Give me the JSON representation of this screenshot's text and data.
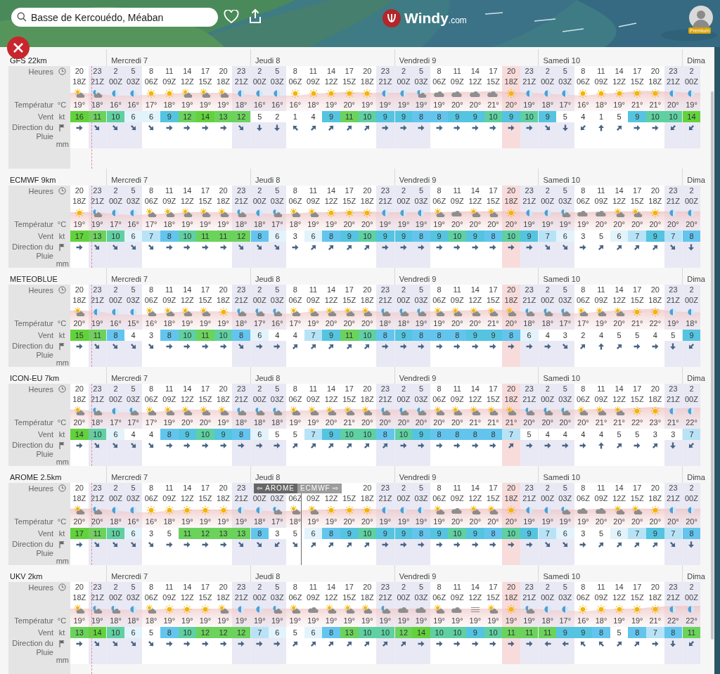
{
  "search": {
    "value": "Basse de Kercouédo, Méaban"
  },
  "logo": {
    "name": "Windy",
    "suffix": ".com"
  },
  "account": {
    "badge": "Premium"
  },
  "columns": [
    {
      "night": false,
      "highlight": false,
      "day_start": false
    },
    {
      "night": true,
      "highlight": false,
      "day_start": false
    },
    {
      "night": true,
      "highlight": false,
      "day_start": true
    },
    {
      "night": true,
      "highlight": false,
      "day_start": false
    },
    {
      "night": false,
      "highlight": false,
      "day_start": false
    },
    {
      "night": false,
      "highlight": false,
      "day_start": false
    },
    {
      "night": false,
      "highlight": false,
      "day_start": false
    },
    {
      "night": false,
      "highlight": false,
      "day_start": false
    },
    {
      "night": false,
      "highlight": false,
      "day_start": false
    },
    {
      "night": true,
      "highlight": false,
      "day_start": false
    },
    {
      "night": true,
      "highlight": false,
      "day_start": true
    },
    {
      "night": true,
      "highlight": false,
      "day_start": false
    },
    {
      "night": false,
      "highlight": false,
      "day_start": false
    },
    {
      "night": false,
      "highlight": false,
      "day_start": false
    },
    {
      "night": false,
      "highlight": false,
      "day_start": false
    },
    {
      "night": false,
      "highlight": false,
      "day_start": false
    },
    {
      "night": false,
      "highlight": false,
      "day_start": false
    },
    {
      "night": true,
      "highlight": false,
      "day_start": false
    },
    {
      "night": true,
      "highlight": false,
      "day_start": true
    },
    {
      "night": true,
      "highlight": false,
      "day_start": false
    },
    {
      "night": false,
      "highlight": false,
      "day_start": false
    },
    {
      "night": false,
      "highlight": false,
      "day_start": false
    },
    {
      "night": false,
      "highlight": false,
      "day_start": false
    },
    {
      "night": false,
      "highlight": false,
      "day_start": false
    },
    {
      "night": false,
      "highlight": true,
      "day_start": false
    },
    {
      "night": true,
      "highlight": false,
      "day_start": false
    },
    {
      "night": true,
      "highlight": false,
      "day_start": true
    },
    {
      "night": true,
      "highlight": false,
      "day_start": false
    },
    {
      "night": false,
      "highlight": false,
      "day_start": false
    },
    {
      "night": false,
      "highlight": false,
      "day_start": false
    },
    {
      "night": false,
      "highlight": false,
      "day_start": false
    },
    {
      "night": false,
      "highlight": false,
      "day_start": false
    },
    {
      "night": false,
      "highlight": false,
      "day_start": false
    },
    {
      "night": true,
      "highlight": false,
      "day_start": false
    },
    {
      "night": true,
      "highlight": false,
      "day_start": true
    }
  ],
  "models": [
    {
      "name": "GFS 22km",
      "labels": {
        "hours": "Heures",
        "temperature": "Températur",
        "temperature_unit": "°C",
        "wind": "Vent",
        "wind_unit": "kt",
        "direction": "Direction du",
        "rain": "Pluie",
        "rain_unit": "mm"
      },
      "days": [
        "Mercredi 7",
        "Jeudi 8",
        "Vendredi 9",
        "Samedi 10",
        "Dima"
      ],
      "hours": [
        "20",
        "23",
        "2",
        "5",
        "8",
        "11",
        "14",
        "17",
        "20",
        "23",
        "2",
        "5",
        "8",
        "11",
        "14",
        "17",
        "20",
        "23",
        "2",
        "5",
        "8",
        "11",
        "14",
        "17",
        "20",
        "23",
        "2",
        "5",
        "8",
        "11",
        "14",
        "17",
        "20",
        "23",
        "2"
      ],
      "utc": [
        "18Z",
        "21Z",
        "00Z",
        "03Z",
        "06Z",
        "09Z",
        "12Z",
        "15Z",
        "18Z",
        "21Z",
        "00Z",
        "03Z",
        "06Z",
        "09Z",
        "12Z",
        "15Z",
        "18Z",
        "21Z",
        "00Z",
        "03Z",
        "06Z",
        "09Z",
        "12Z",
        "15Z",
        "18Z",
        "21Z",
        "00Z",
        "03Z",
        "06Z",
        "09Z",
        "12Z",
        "15Z",
        "18Z",
        "21Z",
        "00Z"
      ],
      "icons": [
        {
          "kind": "sun-cloud"
        },
        {
          "kind": "moon-cloud"
        },
        {
          "kind": "moon"
        },
        {
          "kind": "moon"
        },
        {
          "kind": "sun"
        },
        {
          "kind": "sun"
        },
        {
          "kind": "sun-cloud"
        },
        {
          "kind": "sun-cloud"
        },
        {
          "kind": "sun-cloud"
        },
        {
          "kind": "moon"
        },
        {
          "kind": "moon"
        },
        {
          "kind": "moon"
        },
        {
          "kind": "sun"
        },
        {
          "kind": "sun"
        },
        {
          "kind": "sun"
        },
        {
          "kind": "sun"
        },
        {
          "kind": "sun"
        },
        {
          "kind": "moon"
        },
        {
          "kind": "moon"
        },
        {
          "kind": "moon-cloud"
        },
        {
          "kind": "cloud"
        },
        {
          "kind": "cloud"
        },
        {
          "kind": "cloud"
        },
        {
          "kind": "cloud"
        },
        {
          "kind": "sun"
        },
        {
          "kind": "moon"
        },
        {
          "kind": "moon"
        },
        {
          "kind": "moon"
        },
        {
          "kind": "sun"
        },
        {
          "kind": "sun"
        },
        {
          "kind": "sun"
        },
        {
          "kind": "sun"
        },
        {
          "kind": "sun"
        },
        {
          "kind": "moon"
        },
        {
          "kind": "moon"
        }
      ],
      "temperatures": [
        "19°",
        "18°",
        "16°",
        "16°",
        "17°",
        "18°",
        "19°",
        "19°",
        "19°",
        "18°",
        "16°",
        "16°",
        "16°",
        "18°",
        "19°",
        "20°",
        "19°",
        "19°",
        "19°",
        "19°",
        "19°",
        "20°",
        "20°",
        "21°",
        "20°",
        "19°",
        "18°",
        "17°",
        "16°",
        "18°",
        "19°",
        "21°",
        "21°",
        "20°",
        "19°"
      ],
      "wind": [
        "16",
        "11",
        "10",
        "6",
        "6",
        "9",
        "12",
        "14",
        "13",
        "12",
        "5",
        "2",
        "1",
        "4",
        "9",
        "11",
        "10",
        "9",
        "9",
        "8",
        "8",
        "9",
        "9",
        "10",
        "9",
        "10",
        "9",
        "5",
        "4",
        "1",
        "5",
        "9",
        "10",
        "10",
        "14"
      ],
      "directions": [
        {
          "kind": "e"
        },
        {
          "kind": "se"
        },
        {
          "kind": "se"
        },
        {
          "kind": "se"
        },
        {
          "kind": "se"
        },
        {
          "kind": "e"
        },
        {
          "kind": "e"
        },
        {
          "kind": "e"
        },
        {
          "kind": "e"
        },
        {
          "kind": "se"
        },
        {
          "kind": "s"
        },
        {
          "kind": "s"
        },
        {
          "kind": "nw"
        },
        {
          "kind": "ne"
        },
        {
          "kind": "ne"
        },
        {
          "kind": "ne"
        },
        {
          "kind": "ne"
        },
        {
          "kind": "e"
        },
        {
          "kind": "e"
        },
        {
          "kind": "e"
        },
        {
          "kind": "e"
        },
        {
          "kind": "e"
        },
        {
          "kind": "e"
        },
        {
          "kind": "e"
        },
        {
          "kind": "e"
        },
        {
          "kind": "e"
        },
        {
          "kind": "se"
        },
        {
          "kind": "s"
        },
        {
          "kind": "sw"
        },
        {
          "kind": "n"
        },
        {
          "kind": "ne"
        },
        {
          "kind": "e"
        },
        {
          "kind": "e"
        },
        {
          "kind": "sw"
        },
        {
          "kind": "sw"
        }
      ]
    },
    {
      "name": "ECMWF 9km",
      "labels": {
        "hours": "Heures",
        "temperature": "Températur",
        "temperature_unit": "°C",
        "wind": "Vent",
        "wind_unit": "kt",
        "direction": "Direction du",
        "rain": "Pluie",
        "rain_unit": "mm"
      },
      "days": [
        "Mercredi 7",
        "Jeudi 8",
        "Vendredi 9",
        "Samedi 10",
        "Dima"
      ],
      "hours": [
        "20",
        "23",
        "2",
        "5",
        "8",
        "11",
        "14",
        "17",
        "20",
        "23",
        "2",
        "5",
        "8",
        "11",
        "14",
        "17",
        "20",
        "23",
        "2",
        "5",
        "8",
        "11",
        "14",
        "17",
        "20",
        "23",
        "2",
        "5",
        "8",
        "11",
        "14",
        "17",
        "20",
        "23",
        "2"
      ],
      "utc": [
        "18Z",
        "21Z",
        "00Z",
        "03Z",
        "06Z",
        "09Z",
        "12Z",
        "15Z",
        "18Z",
        "21Z",
        "00Z",
        "03Z",
        "06Z",
        "09Z",
        "12Z",
        "15Z",
        "18Z",
        "21Z",
        "00Z",
        "03Z",
        "06Z",
        "09Z",
        "12Z",
        "15Z",
        "18Z",
        "21Z",
        "00Z",
        "03Z",
        "06Z",
        "09Z",
        "12Z",
        "15Z",
        "18Z",
        "21Z",
        "00Z"
      ],
      "icons": [
        {
          "kind": "sun"
        },
        {
          "kind": "moon-cloud"
        },
        {
          "kind": "moon"
        },
        {
          "kind": "moon"
        },
        {
          "kind": "sun-cloud"
        },
        {
          "kind": "sun-cloud"
        },
        {
          "kind": "sun-cloud"
        },
        {
          "kind": "sun-cloud"
        },
        {
          "kind": "sun-cloud"
        },
        {
          "kind": "moon-cloud"
        },
        {
          "kind": "moon"
        },
        {
          "kind": "moon-cloud"
        },
        {
          "kind": "sun-cloud"
        },
        {
          "kind": "sun-cloud"
        },
        {
          "kind": "sun"
        },
        {
          "kind": "sun"
        },
        {
          "kind": "sun"
        },
        {
          "kind": "moon"
        },
        {
          "kind": "moon"
        },
        {
          "kind": "moon"
        },
        {
          "kind": "sun-cloud"
        },
        {
          "kind": "cloud"
        },
        {
          "kind": "sun-cloud"
        },
        {
          "kind": "sun-cloud"
        },
        {
          "kind": "sun"
        },
        {
          "kind": "moon"
        },
        {
          "kind": "moon"
        },
        {
          "kind": "moon-cloud"
        },
        {
          "kind": "cloud"
        },
        {
          "kind": "cloud"
        },
        {
          "kind": "sun-cloud"
        },
        {
          "kind": "sun-cloud"
        },
        {
          "kind": "sun"
        },
        {
          "kind": "moon"
        },
        {
          "kind": "moon"
        }
      ],
      "temperatures": [
        "19°",
        "19°",
        "17°",
        "16°",
        "17°",
        "18°",
        "19°",
        "19°",
        "19°",
        "18°",
        "18°",
        "17°",
        "18°",
        "19°",
        "19°",
        "20°",
        "20°",
        "19°",
        "19°",
        "19°",
        "19°",
        "20°",
        "20°",
        "20°",
        "20°",
        "19°",
        "19°",
        "19°",
        "19°",
        "20°",
        "20°",
        "20°",
        "20°",
        "20°",
        "20°"
      ],
      "wind": [
        "17",
        "13",
        "10",
        "6",
        "7",
        "8",
        "10",
        "11",
        "11",
        "12",
        "8",
        "6",
        "3",
        "6",
        "8",
        "9",
        "10",
        "9",
        "9",
        "8",
        "9",
        "10",
        "9",
        "8",
        "10",
        "9",
        "7",
        "6",
        "3",
        "5",
        "6",
        "7",
        "9",
        "7",
        "8"
      ],
      "directions": [
        {
          "kind": "e"
        },
        {
          "kind": "se"
        },
        {
          "kind": "se"
        },
        {
          "kind": "se"
        },
        {
          "kind": "se"
        },
        {
          "kind": "e"
        },
        {
          "kind": "e"
        },
        {
          "kind": "e"
        },
        {
          "kind": "e"
        },
        {
          "kind": "se"
        },
        {
          "kind": "se"
        },
        {
          "kind": "se"
        },
        {
          "kind": "e"
        },
        {
          "kind": "ne"
        },
        {
          "kind": "ne"
        },
        {
          "kind": "ne"
        },
        {
          "kind": "ne"
        },
        {
          "kind": "e"
        },
        {
          "kind": "e"
        },
        {
          "kind": "e"
        },
        {
          "kind": "e"
        },
        {
          "kind": "e"
        },
        {
          "kind": "e"
        },
        {
          "kind": "e"
        },
        {
          "kind": "e"
        },
        {
          "kind": "e"
        },
        {
          "kind": "se"
        },
        {
          "kind": "se"
        },
        {
          "kind": "e"
        },
        {
          "kind": "ne"
        },
        {
          "kind": "ne"
        },
        {
          "kind": "ne"
        },
        {
          "kind": "ne"
        },
        {
          "kind": "se"
        },
        {
          "kind": "s"
        }
      ]
    },
    {
      "name": "METEOBLUE",
      "labels": {
        "hours": "Heures",
        "temperature": "Températur",
        "temperature_unit": "°C",
        "wind": "Vent",
        "wind_unit": "kt",
        "direction": "Direction du",
        "rain": "Pluie",
        "rain_unit": "mm"
      },
      "days": [
        "Mercredi 7",
        "Jeudi 8",
        "Vendredi 9",
        "Samedi 10",
        "Dima"
      ],
      "hours": [
        "20",
        "23",
        "2",
        "5",
        "8",
        "11",
        "14",
        "17",
        "20",
        "23",
        "2",
        "5",
        "8",
        "11",
        "14",
        "17",
        "20",
        "23",
        "2",
        "5",
        "8",
        "11",
        "14",
        "17",
        "20",
        "23",
        "2",
        "5",
        "8",
        "11",
        "14",
        "17",
        "20",
        "23",
        "2"
      ],
      "utc": [
        "18Z",
        "21Z",
        "00Z",
        "03Z",
        "06Z",
        "09Z",
        "12Z",
        "15Z",
        "18Z",
        "21Z",
        "00Z",
        "03Z",
        "06Z",
        "09Z",
        "12Z",
        "15Z",
        "18Z",
        "21Z",
        "00Z",
        "03Z",
        "06Z",
        "09Z",
        "12Z",
        "15Z",
        "18Z",
        "21Z",
        "00Z",
        "03Z",
        "06Z",
        "09Z",
        "12Z",
        "15Z",
        "18Z",
        "21Z",
        "00Z"
      ],
      "icons": [
        {
          "kind": "sun-cloud"
        },
        {
          "kind": "moon"
        },
        {
          "kind": "moon"
        },
        {
          "kind": "moon"
        },
        {
          "kind": "sun-cloud"
        },
        {
          "kind": "sun-cloud"
        },
        {
          "kind": "sun-cloud"
        },
        {
          "kind": "sun-cloud"
        },
        {
          "kind": "sun"
        },
        {
          "kind": "moon-cloud"
        },
        {
          "kind": "moon-cloud"
        },
        {
          "kind": "moon-cloud"
        },
        {
          "kind": "sun-cloud"
        },
        {
          "kind": "sun-cloud"
        },
        {
          "kind": "sun-cloud"
        },
        {
          "kind": "sun-cloud"
        },
        {
          "kind": "sun-cloud"
        },
        {
          "kind": "moon-cloud"
        },
        {
          "kind": "moon-cloud"
        },
        {
          "kind": "moon-cloud"
        },
        {
          "kind": "sun-cloud"
        },
        {
          "kind": "sun-cloud"
        },
        {
          "kind": "sun-cloud"
        },
        {
          "kind": "sun-cloud"
        },
        {
          "kind": "sun-cloud"
        },
        {
          "kind": "moon-cloud"
        },
        {
          "kind": "moon-cloud"
        },
        {
          "kind": "moon-cloud"
        },
        {
          "kind": "sun-cloud"
        },
        {
          "kind": "sun-cloud"
        },
        {
          "kind": "sun-cloud"
        },
        {
          "kind": "sun"
        },
        {
          "kind": "sun"
        },
        {
          "kind": "moon"
        },
        {
          "kind": "moon"
        }
      ],
      "temperatures": [
        "20°",
        "19°",
        "16°",
        "15°",
        "16°",
        "18°",
        "19°",
        "19°",
        "19°",
        "18°",
        "17°",
        "16°",
        "17°",
        "19°",
        "20°",
        "20°",
        "20°",
        "18°",
        "18°",
        "19°",
        "19°",
        "20°",
        "20°",
        "21°",
        "20°",
        "18°",
        "18°",
        "17°",
        "17°",
        "19°",
        "20°",
        "21°",
        "22°",
        "19°",
        "18°"
      ],
      "wind": [
        "15",
        "11",
        "8",
        "4",
        "3",
        "8",
        "10",
        "11",
        "10",
        "8",
        "6",
        "4",
        "4",
        "7",
        "9",
        "11",
        "10",
        "8",
        "9",
        "8",
        "8",
        "8",
        "9",
        "9",
        "8",
        "6",
        "4",
        "3",
        "2",
        "4",
        "5",
        "5",
        "4",
        "5",
        "9"
      ],
      "directions": [
        {
          "kind": "e"
        },
        {
          "kind": "se"
        },
        {
          "kind": "se"
        },
        {
          "kind": "se"
        },
        {
          "kind": "se"
        },
        {
          "kind": "e"
        },
        {
          "kind": "e"
        },
        {
          "kind": "e"
        },
        {
          "kind": "e"
        },
        {
          "kind": "se"
        },
        {
          "kind": "e"
        },
        {
          "kind": "e"
        },
        {
          "kind": "ne"
        },
        {
          "kind": "ne"
        },
        {
          "kind": "ne"
        },
        {
          "kind": "ne"
        },
        {
          "kind": "ne"
        },
        {
          "kind": "e"
        },
        {
          "kind": "e"
        },
        {
          "kind": "e"
        },
        {
          "kind": "e"
        },
        {
          "kind": "e"
        },
        {
          "kind": "e"
        },
        {
          "kind": "e"
        },
        {
          "kind": "e"
        },
        {
          "kind": "e"
        },
        {
          "kind": "e"
        },
        {
          "kind": "se"
        },
        {
          "kind": "ne"
        },
        {
          "kind": "n"
        },
        {
          "kind": "ne"
        },
        {
          "kind": "e"
        },
        {
          "kind": "e"
        },
        {
          "kind": "s"
        },
        {
          "kind": "sw"
        }
      ]
    },
    {
      "name": "ICON-EU 7km",
      "labels": {
        "hours": "Heures",
        "temperature": "Températur",
        "temperature_unit": "°C",
        "wind": "Vent",
        "wind_unit": "kt",
        "direction": "Direction du",
        "rain": "Pluie",
        "rain_unit": "mm"
      },
      "days": [
        "Mercredi 7",
        "Jeudi 8",
        "Vendredi 9",
        "Samedi 10",
        "Dima"
      ],
      "hours": [
        "20",
        "23",
        "2",
        "5",
        "8",
        "11",
        "14",
        "17",
        "20",
        "23",
        "2",
        "5",
        "8",
        "11",
        "14",
        "17",
        "20",
        "23",
        "2",
        "5",
        "8",
        "11",
        "14",
        "17",
        "20",
        "23",
        "2",
        "5",
        "8",
        "11",
        "14",
        "17",
        "20",
        "23",
        "2"
      ],
      "utc": [
        "18Z",
        "21Z",
        "00Z",
        "03Z",
        "06Z",
        "09Z",
        "12Z",
        "15Z",
        "18Z",
        "21Z",
        "00Z",
        "03Z",
        "06Z",
        "09Z",
        "12Z",
        "15Z",
        "18Z",
        "21Z",
        "00Z",
        "03Z",
        "06Z",
        "09Z",
        "12Z",
        "15Z",
        "18Z",
        "21Z",
        "00Z",
        "03Z",
        "06Z",
        "09Z",
        "12Z",
        "15Z",
        "18Z",
        "21Z",
        "00Z"
      ],
      "icons": [
        {
          "kind": "sun-cloud"
        },
        {
          "kind": "moon-cloud"
        },
        {
          "kind": "moon"
        },
        {
          "kind": "moon-cloud"
        },
        {
          "kind": "sun-cloud"
        },
        {
          "kind": "sun-cloud"
        },
        {
          "kind": "sun-cloud"
        },
        {
          "kind": "sun-cloud"
        },
        {
          "kind": "sun-cloud"
        },
        {
          "kind": "moon-cloud"
        },
        {
          "kind": "moon-cloud"
        },
        {
          "kind": "moon-cloud"
        },
        {
          "kind": "sun-cloud"
        },
        {
          "kind": "sun-cloud"
        },
        {
          "kind": "sun-cloud"
        },
        {
          "kind": "sun-cloud"
        },
        {
          "kind": "sun-cloud"
        },
        {
          "kind": "moon-cloud"
        },
        {
          "kind": "moon-cloud"
        },
        {
          "kind": "moon-cloud"
        },
        {
          "kind": "sun-cloud"
        },
        {
          "kind": "sun-cloud"
        },
        {
          "kind": "sun-cloud"
        },
        {
          "kind": "sun-cloud"
        },
        {
          "kind": "sun-cloud"
        },
        {
          "kind": "moon-cloud"
        },
        {
          "kind": "moon-cloud"
        },
        {
          "kind": "moon-cloud"
        },
        {
          "kind": "sun-cloud"
        },
        {
          "kind": "sun-cloud"
        },
        {
          "kind": "sun-cloud"
        },
        {
          "kind": "sun"
        },
        {
          "kind": "sun"
        },
        {
          "kind": "moon"
        },
        {
          "kind": "moon"
        }
      ],
      "temperatures": [
        "20°",
        "18°",
        "17°",
        "17°",
        "17°",
        "19°",
        "20°",
        "20°",
        "19°",
        "18°",
        "18°",
        "18°",
        "19°",
        "19°",
        "20°",
        "21°",
        "20°",
        "20°",
        "20°",
        "20°",
        "20°",
        "20°",
        "21°",
        "21°",
        "21°",
        "20°",
        "20°",
        "20°",
        "20°",
        "21°",
        "21°",
        "22°",
        "23°",
        "21°",
        "22°"
      ],
      "wind": [
        "14",
        "10",
        "6",
        "4",
        "4",
        "8",
        "9",
        "10",
        "9",
        "8",
        "6",
        "5",
        "5",
        "7",
        "9",
        "10",
        "10",
        "8",
        "10",
        "9",
        "8",
        "8",
        "8",
        "8",
        "7",
        "5",
        "4",
        "4",
        "4",
        "4",
        "5",
        "5",
        "3",
        "3",
        "7"
      ],
      "directions": [
        {
          "kind": "e"
        },
        {
          "kind": "se"
        },
        {
          "kind": "se"
        },
        {
          "kind": "se"
        },
        {
          "kind": "se"
        },
        {
          "kind": "e"
        },
        {
          "kind": "e"
        },
        {
          "kind": "e"
        },
        {
          "kind": "e"
        },
        {
          "kind": "e"
        },
        {
          "kind": "e"
        },
        {
          "kind": "e"
        },
        {
          "kind": "ne"
        },
        {
          "kind": "ne"
        },
        {
          "kind": "ne"
        },
        {
          "kind": "ne"
        },
        {
          "kind": "ne"
        },
        {
          "kind": "ne"
        },
        {
          "kind": "e"
        },
        {
          "kind": "e"
        },
        {
          "kind": "e"
        },
        {
          "kind": "e"
        },
        {
          "kind": "e"
        },
        {
          "kind": "e"
        },
        {
          "kind": "ne"
        },
        {
          "kind": "e"
        },
        {
          "kind": "e"
        },
        {
          "kind": "e"
        },
        {
          "kind": "e"
        },
        {
          "kind": "n"
        },
        {
          "kind": "ne"
        },
        {
          "kind": "e"
        },
        {
          "kind": "ne"
        },
        {
          "kind": "s"
        },
        {
          "kind": "sw"
        }
      ]
    },
    {
      "name": "AROME 2.5km",
      "labels": {
        "hours": "Heures",
        "temperature": "Températur",
        "temperature_unit": "°C",
        "wind": "Vent",
        "wind_unit": "kt",
        "direction": "Direction du",
        "rain": "Pluie",
        "rain_unit": "mm"
      },
      "days": [
        "Mercredi 7",
        "Jeudi 8",
        "Vendredi 9",
        "Samedi 10",
        "Dima"
      ],
      "switch": {
        "left": "⇦ AROME",
        "right": "ECMWF ⇨"
      },
      "hours": [
        "20",
        "23",
        "2",
        "5",
        "8",
        "11",
        "14",
        "17",
        "20",
        "23"
      ],
      "hours_after_switch": [
        "20",
        "23",
        "2",
        "5",
        "8",
        "11",
        "14",
        "17",
        "20",
        "23",
        "2",
        "5",
        "8",
        "11",
        "14",
        "17",
        "20",
        "23",
        "2"
      ],
      "utc": [
        "18Z",
        "21Z",
        "00Z",
        "03Z",
        "06Z",
        "09Z",
        "12Z",
        "15Z",
        "18Z",
        "21Z",
        "00Z",
        "03Z",
        "06Z",
        "09Z",
        "12Z",
        "15Z",
        "18Z",
        "21Z",
        "00Z",
        "03Z",
        "06Z",
        "09Z",
        "12Z",
        "15Z",
        "18Z",
        "21Z",
        "00Z",
        "03Z",
        "06Z",
        "09Z",
        "12Z",
        "15Z",
        "18Z",
        "21Z",
        "00Z"
      ],
      "icons": [
        {
          "kind": "sun-cloud"
        },
        {
          "kind": "moon-cloud"
        },
        {
          "kind": "moon"
        },
        {
          "kind": "moon"
        },
        {
          "kind": "sun"
        },
        {
          "kind": "sun"
        },
        {
          "kind": "sun"
        },
        {
          "kind": "sun"
        },
        {
          "kind": "sun"
        },
        {
          "kind": "moon"
        },
        {
          "kind": "moon"
        },
        {
          "kind": "moon-cloud"
        },
        {
          "kind": "sun-cloud"
        },
        {
          "kind": "sun-cloud"
        },
        {
          "kind": "sun"
        },
        {
          "kind": "sun"
        },
        {
          "kind": "sun"
        },
        {
          "kind": "moon"
        },
        {
          "kind": "moon"
        },
        {
          "kind": "moon"
        },
        {
          "kind": "sun-cloud"
        },
        {
          "kind": "cloud"
        },
        {
          "kind": "sun-cloud"
        },
        {
          "kind": "sun-cloud"
        },
        {
          "kind": "sun"
        },
        {
          "kind": "moon"
        },
        {
          "kind": "moon"
        },
        {
          "kind": "moon-cloud"
        },
        {
          "kind": "cloud"
        },
        {
          "kind": "cloud"
        },
        {
          "kind": "sun-cloud"
        },
        {
          "kind": "sun-cloud"
        },
        {
          "kind": "sun"
        },
        {
          "kind": "moon"
        },
        {
          "kind": "moon"
        }
      ],
      "temperatures": [
        "20°",
        "20°",
        "18°",
        "16°",
        "16°",
        "18°",
        "19°",
        "19°",
        "19°",
        "19°",
        "18°",
        "17°",
        "18°",
        "19°",
        "19°",
        "20°",
        "20°",
        "19°",
        "19°",
        "19°",
        "19°",
        "20°",
        "20°",
        "20°",
        "20°",
        "19°",
        "19°",
        "19°",
        "19°",
        "20°",
        "20°",
        "20°",
        "20°",
        "20°",
        "20°"
      ],
      "wind": [
        "17",
        "11",
        "10",
        "6",
        "3",
        "5",
        "11",
        "12",
        "13",
        "13",
        "8",
        "3",
        "5",
        "6",
        "8",
        "9",
        "10",
        "9",
        "9",
        "8",
        "9",
        "10",
        "9",
        "8",
        "10",
        "9",
        "7",
        "6",
        "3",
        "5",
        "6",
        "7",
        "9",
        "7",
        "8"
      ],
      "directions": [
        {
          "kind": "e"
        },
        {
          "kind": "se"
        },
        {
          "kind": "se"
        },
        {
          "kind": "se"
        },
        {
          "kind": "se"
        },
        {
          "kind": "e"
        },
        {
          "kind": "e"
        },
        {
          "kind": "e"
        },
        {
          "kind": "e"
        },
        {
          "kind": "se"
        },
        {
          "kind": "se"
        },
        {
          "kind": "sw"
        },
        {
          "kind": "se"
        },
        {
          "kind": "ne"
        },
        {
          "kind": "ne"
        },
        {
          "kind": "ne"
        },
        {
          "kind": "ne"
        },
        {
          "kind": "e"
        },
        {
          "kind": "e"
        },
        {
          "kind": "e"
        },
        {
          "kind": "e"
        },
        {
          "kind": "e"
        },
        {
          "kind": "e"
        },
        {
          "kind": "e"
        },
        {
          "kind": "e"
        },
        {
          "kind": "e"
        },
        {
          "kind": "se"
        },
        {
          "kind": "se"
        },
        {
          "kind": "e"
        },
        {
          "kind": "ne"
        },
        {
          "kind": "ne"
        },
        {
          "kind": "ne"
        },
        {
          "kind": "ne"
        },
        {
          "kind": "se"
        },
        {
          "kind": "s"
        }
      ]
    },
    {
      "name": "UKV 2km",
      "labels": {
        "hours": "Heures",
        "temperature": "Températur",
        "temperature_unit": "°C",
        "wind": "Vent",
        "wind_unit": "kt",
        "direction": "Direction du",
        "rain": "Pluie",
        "rain_unit": "mm"
      },
      "days": [
        "Mercredi 7",
        "Jeudi 8",
        "Vendredi 9",
        "Samedi 10",
        "Dima"
      ],
      "hours": [
        "20",
        "23",
        "2",
        "5",
        "8",
        "11",
        "14",
        "17",
        "20",
        "23",
        "2",
        "5",
        "8",
        "11",
        "14",
        "17",
        "20",
        "23",
        "2",
        "5",
        "8",
        "11",
        "14",
        "17",
        "20",
        "23",
        "2",
        "5",
        "8",
        "11",
        "14",
        "17",
        "20",
        "23",
        "2"
      ],
      "utc": [
        "18Z",
        "21Z",
        "00Z",
        "03Z",
        "06Z",
        "09Z",
        "12Z",
        "15Z",
        "18Z",
        "21Z",
        "00Z",
        "03Z",
        "06Z",
        "09Z",
        "12Z",
        "15Z",
        "18Z",
        "21Z",
        "00Z",
        "03Z",
        "06Z",
        "09Z",
        "12Z",
        "15Z",
        "18Z",
        "21Z",
        "00Z",
        "03Z",
        "06Z",
        "09Z",
        "12Z",
        "15Z",
        "18Z",
        "21Z",
        "00Z"
      ],
      "icons": [
        {
          "kind": "sun-cloud"
        },
        {
          "kind": "moon-cloud"
        },
        {
          "kind": "moon-cloud"
        },
        {
          "kind": "moon"
        },
        {
          "kind": "sun-cloud"
        },
        {
          "kind": "sun"
        },
        {
          "kind": "sun"
        },
        {
          "kind": "sun"
        },
        {
          "kind": "sun-cloud"
        },
        {
          "kind": "moon"
        },
        {
          "kind": "moon"
        },
        {
          "kind": "moon-cloud"
        },
        {
          "kind": "sun-cloud"
        },
        {
          "kind": "cloud"
        },
        {
          "kind": "sun-cloud"
        },
        {
          "kind": "sun-cloud"
        },
        {
          "kind": "sun-cloud"
        },
        {
          "kind": "moon-cloud"
        },
        {
          "kind": "cloud"
        },
        {
          "kind": "cloud"
        },
        {
          "kind": "sun-cloud"
        },
        {
          "kind": "cloud"
        },
        {
          "kind": "fog"
        },
        {
          "kind": "sun-cloud"
        },
        {
          "kind": "sun"
        },
        {
          "kind": "moon-cloud"
        },
        {
          "kind": "moon"
        },
        {
          "kind": "moon"
        },
        {
          "kind": "sun"
        },
        {
          "kind": "sun"
        },
        {
          "kind": "sun"
        },
        {
          "kind": "sun"
        },
        {
          "kind": "sun"
        },
        {
          "kind": "moon"
        },
        {
          "kind": "moon"
        }
      ],
      "temperatures": [
        "19°",
        "19°",
        "18°",
        "18°",
        "18°",
        "19°",
        "19°",
        "19°",
        "19°",
        "19°",
        "19°",
        "19°",
        "19°",
        "19°",
        "19°",
        "19°",
        "19°",
        "19°",
        "19°",
        "19°",
        "19°",
        "19°",
        "19°",
        "19°",
        "19°",
        "19°",
        "18°",
        "17°",
        "16°",
        "18°",
        "19°",
        "19°",
        "21°",
        "22°",
        "22°"
      ],
      "wind": [
        "13",
        "14",
        "10",
        "6",
        "5",
        "8",
        "10",
        "12",
        "12",
        "12",
        "7",
        "6",
        "5",
        "6",
        "8",
        "13",
        "10",
        "10",
        "12",
        "14",
        "10",
        "10",
        "9",
        "10",
        "11",
        "11",
        "11",
        "9",
        "9",
        "8",
        "5",
        "8",
        "7",
        "8",
        "11"
      ],
      "directions": [
        {
          "kind": "e"
        },
        {
          "kind": "se"
        },
        {
          "kind": "se"
        },
        {
          "kind": "se"
        },
        {
          "kind": "se"
        },
        {
          "kind": "e"
        },
        {
          "kind": "e"
        },
        {
          "kind": "e"
        },
        {
          "kind": "e"
        },
        {
          "kind": "e"
        },
        {
          "kind": "e"
        },
        {
          "kind": "e"
        },
        {
          "kind": "ne"
        },
        {
          "kind": "ne"
        },
        {
          "kind": "ne"
        },
        {
          "kind": "ne"
        },
        {
          "kind": "ne"
        },
        {
          "kind": "ne"
        },
        {
          "kind": "ne"
        },
        {
          "kind": "e"
        },
        {
          "kind": "e"
        },
        {
          "kind": "e"
        },
        {
          "kind": "e"
        },
        {
          "kind": "e"
        },
        {
          "kind": "e"
        },
        {
          "kind": "e"
        },
        {
          "kind": "w"
        },
        {
          "kind": "w"
        },
        {
          "kind": "nw"
        },
        {
          "kind": "nw"
        },
        {
          "kind": "ne"
        },
        {
          "kind": "ne"
        },
        {
          "kind": "e"
        },
        {
          "kind": "s"
        },
        {
          "kind": "sw"
        }
      ]
    }
  ]
}
